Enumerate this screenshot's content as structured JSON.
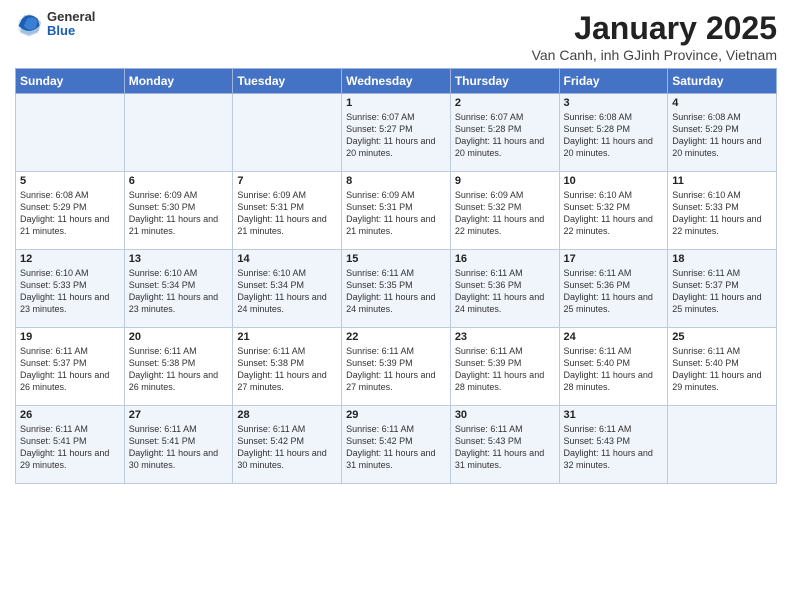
{
  "header": {
    "logo_general": "General",
    "logo_blue": "Blue",
    "month": "January 2025",
    "location": "Van Canh, inh GJinh Province, Vietnam"
  },
  "days_of_week": [
    "Sunday",
    "Monday",
    "Tuesday",
    "Wednesday",
    "Thursday",
    "Friday",
    "Saturday"
  ],
  "weeks": [
    [
      {
        "day": "",
        "info": ""
      },
      {
        "day": "",
        "info": ""
      },
      {
        "day": "",
        "info": ""
      },
      {
        "day": "1",
        "info": "Sunrise: 6:07 AM\nSunset: 5:27 PM\nDaylight: 11 hours and 20 minutes."
      },
      {
        "day": "2",
        "info": "Sunrise: 6:07 AM\nSunset: 5:28 PM\nDaylight: 11 hours and 20 minutes."
      },
      {
        "day": "3",
        "info": "Sunrise: 6:08 AM\nSunset: 5:28 PM\nDaylight: 11 hours and 20 minutes."
      },
      {
        "day": "4",
        "info": "Sunrise: 6:08 AM\nSunset: 5:29 PM\nDaylight: 11 hours and 20 minutes."
      }
    ],
    [
      {
        "day": "5",
        "info": "Sunrise: 6:08 AM\nSunset: 5:29 PM\nDaylight: 11 hours and 21 minutes."
      },
      {
        "day": "6",
        "info": "Sunrise: 6:09 AM\nSunset: 5:30 PM\nDaylight: 11 hours and 21 minutes."
      },
      {
        "day": "7",
        "info": "Sunrise: 6:09 AM\nSunset: 5:31 PM\nDaylight: 11 hours and 21 minutes."
      },
      {
        "day": "8",
        "info": "Sunrise: 6:09 AM\nSunset: 5:31 PM\nDaylight: 11 hours and 21 minutes."
      },
      {
        "day": "9",
        "info": "Sunrise: 6:09 AM\nSunset: 5:32 PM\nDaylight: 11 hours and 22 minutes."
      },
      {
        "day": "10",
        "info": "Sunrise: 6:10 AM\nSunset: 5:32 PM\nDaylight: 11 hours and 22 minutes."
      },
      {
        "day": "11",
        "info": "Sunrise: 6:10 AM\nSunset: 5:33 PM\nDaylight: 11 hours and 22 minutes."
      }
    ],
    [
      {
        "day": "12",
        "info": "Sunrise: 6:10 AM\nSunset: 5:33 PM\nDaylight: 11 hours and 23 minutes."
      },
      {
        "day": "13",
        "info": "Sunrise: 6:10 AM\nSunset: 5:34 PM\nDaylight: 11 hours and 23 minutes."
      },
      {
        "day": "14",
        "info": "Sunrise: 6:10 AM\nSunset: 5:34 PM\nDaylight: 11 hours and 24 minutes."
      },
      {
        "day": "15",
        "info": "Sunrise: 6:11 AM\nSunset: 5:35 PM\nDaylight: 11 hours and 24 minutes."
      },
      {
        "day": "16",
        "info": "Sunrise: 6:11 AM\nSunset: 5:36 PM\nDaylight: 11 hours and 24 minutes."
      },
      {
        "day": "17",
        "info": "Sunrise: 6:11 AM\nSunset: 5:36 PM\nDaylight: 11 hours and 25 minutes."
      },
      {
        "day": "18",
        "info": "Sunrise: 6:11 AM\nSunset: 5:37 PM\nDaylight: 11 hours and 25 minutes."
      }
    ],
    [
      {
        "day": "19",
        "info": "Sunrise: 6:11 AM\nSunset: 5:37 PM\nDaylight: 11 hours and 26 minutes."
      },
      {
        "day": "20",
        "info": "Sunrise: 6:11 AM\nSunset: 5:38 PM\nDaylight: 11 hours and 26 minutes."
      },
      {
        "day": "21",
        "info": "Sunrise: 6:11 AM\nSunset: 5:38 PM\nDaylight: 11 hours and 27 minutes."
      },
      {
        "day": "22",
        "info": "Sunrise: 6:11 AM\nSunset: 5:39 PM\nDaylight: 11 hours and 27 minutes."
      },
      {
        "day": "23",
        "info": "Sunrise: 6:11 AM\nSunset: 5:39 PM\nDaylight: 11 hours and 28 minutes."
      },
      {
        "day": "24",
        "info": "Sunrise: 6:11 AM\nSunset: 5:40 PM\nDaylight: 11 hours and 28 minutes."
      },
      {
        "day": "25",
        "info": "Sunrise: 6:11 AM\nSunset: 5:40 PM\nDaylight: 11 hours and 29 minutes."
      }
    ],
    [
      {
        "day": "26",
        "info": "Sunrise: 6:11 AM\nSunset: 5:41 PM\nDaylight: 11 hours and 29 minutes."
      },
      {
        "day": "27",
        "info": "Sunrise: 6:11 AM\nSunset: 5:41 PM\nDaylight: 11 hours and 30 minutes."
      },
      {
        "day": "28",
        "info": "Sunrise: 6:11 AM\nSunset: 5:42 PM\nDaylight: 11 hours and 30 minutes."
      },
      {
        "day": "29",
        "info": "Sunrise: 6:11 AM\nSunset: 5:42 PM\nDaylight: 11 hours and 31 minutes."
      },
      {
        "day": "30",
        "info": "Sunrise: 6:11 AM\nSunset: 5:43 PM\nDaylight: 11 hours and 31 minutes."
      },
      {
        "day": "31",
        "info": "Sunrise: 6:11 AM\nSunset: 5:43 PM\nDaylight: 11 hours and 32 minutes."
      },
      {
        "day": "",
        "info": ""
      }
    ]
  ]
}
